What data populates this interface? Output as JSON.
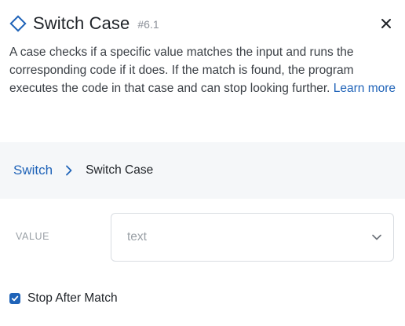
{
  "header": {
    "title": "Switch Case",
    "tag": "#6.1",
    "icon": "diamond-icon",
    "close_icon": "close-icon"
  },
  "description": {
    "text": "A case checks if a specific value matches the input and runs the corresponding code if it does. If the match is found, the program executes the code in that case and can stop looking further. ",
    "link": "Learn more"
  },
  "breadcrumb": {
    "parent": "Switch",
    "current": "Switch Case",
    "separator_icon": "chevron-right-icon"
  },
  "value_field": {
    "label": "VALUE",
    "placeholder": "text",
    "caret_icon": "chevron-down-icon"
  },
  "stop_after_match": {
    "label": "Stop After Match",
    "checked": true
  },
  "colors": {
    "accent": "#1f63b8",
    "text": "#1f2328",
    "muted": "#9aa0a6",
    "panel_bg": "#f5f7f9"
  }
}
